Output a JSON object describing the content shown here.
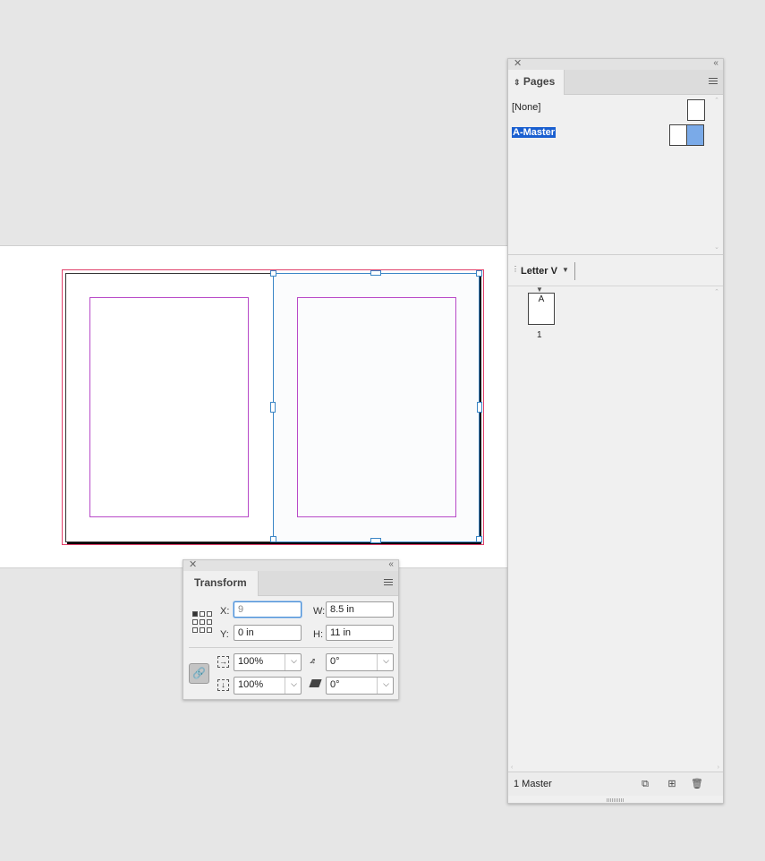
{
  "pages_panel": {
    "tab_label": "Pages",
    "none_label": "[None]",
    "master_label": "A-Master",
    "page_size": "Letter V",
    "page_prefix": "A",
    "page_number": "1",
    "status": "1 Master"
  },
  "transform_panel": {
    "tab_label": "Transform",
    "x_label": "X:",
    "x_value": "9",
    "y_label": "Y:",
    "y_value": "0 in",
    "w_label": "W:",
    "w_value": "8.5 in",
    "h_label": "H:",
    "h_value": "11 in",
    "scale_x": "100%",
    "scale_y": "100%",
    "rotation": "0°",
    "shear": "0°"
  },
  "colors": {
    "selection": "#3b86c6",
    "margin": "#b84ac8",
    "bleed": "#e0406a",
    "highlight": "#1a5fd0"
  }
}
